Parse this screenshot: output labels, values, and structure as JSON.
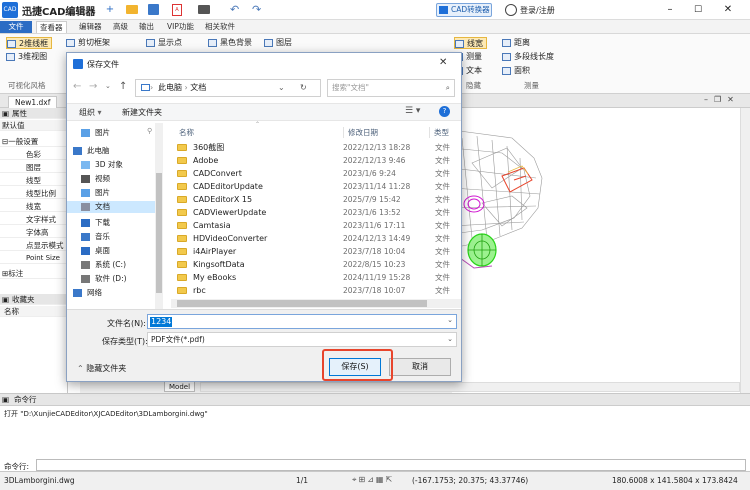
{
  "app": {
    "logo": "CAD",
    "title": "迅捷CAD编辑器",
    "converter": "CAD转换器",
    "login": "登录/注册"
  },
  "menu": [
    "文件",
    "查看器",
    "编辑器",
    "高级",
    "输出",
    "VIP功能",
    "相关软件"
  ],
  "ribbon": {
    "col1": [
      "2维线框",
      "3维视图"
    ],
    "group1_label": "可视化风格",
    "col2": [
      "剪切框架",
      "显示点"
    ],
    "col3": [
      "黑色背景",
      "图层"
    ],
    "col4": [
      "线宽",
      "测量",
      "文本"
    ],
    "col4_label": "隐藏",
    "col5": [
      "距离",
      "多段线长度",
      "面积"
    ],
    "col5_label": "测量"
  },
  "doctab": "New1.dxf",
  "leftpanel": {
    "header": "属性",
    "default": "默认值",
    "general": "一般设置",
    "props": [
      "色彩",
      "图层",
      "线型",
      "线型比例",
      "线宽",
      "文字样式",
      "字体高",
      "点显示模式",
      "Point Size"
    ],
    "annotation": "标注",
    "favorites": "收藏夹",
    "name_col": "名称"
  },
  "model_tab": "Model",
  "command": {
    "title": "命令行",
    "log": "打开 \"D:\\XunjieCADEditor\\XJCADEditor\\3DLamborgini.dwg\"",
    "prompt": "命令行:"
  },
  "status": {
    "file": "3DLamborgini.dwg",
    "page": "1/1",
    "coords": "(-167.1753; 20.375; 43.37746)",
    "size": "180.6008 x 141.5804 x 173.8424"
  },
  "dialog": {
    "title": "保存文件",
    "breadcrumb": [
      "此电脑",
      "文档"
    ],
    "search_placeholder": "搜索\"文档\"",
    "organize": "组织",
    "new_folder": "新建文件夹",
    "nav": [
      {
        "label": "图片",
        "icon": "picture-icon"
      },
      {
        "label": "此电脑",
        "icon": "computer-icon"
      },
      {
        "label": "3D 对象",
        "icon": "cube-icon"
      },
      {
        "label": "视频",
        "icon": "video-icon"
      },
      {
        "label": "图片",
        "icon": "picture-icon"
      },
      {
        "label": "文档",
        "icon": "document-icon"
      },
      {
        "label": "下载",
        "icon": "download-icon"
      },
      {
        "label": "音乐",
        "icon": "music-icon"
      },
      {
        "label": "桌面",
        "icon": "desktop-icon"
      },
      {
        "label": "系统 (C:)",
        "icon": "drive-icon"
      },
      {
        "label": "软件 (D:)",
        "icon": "drive-icon"
      },
      {
        "label": "网络",
        "icon": "network-icon"
      }
    ],
    "columns": [
      "名称",
      "修改日期",
      "类型"
    ],
    "files": [
      {
        "name": "360截图",
        "date": "2022/12/13 18:28",
        "type": "文件"
      },
      {
        "name": "Adobe",
        "date": "2022/12/13 9:46",
        "type": "文件"
      },
      {
        "name": "CADConvert",
        "date": "2023/1/6 9:24",
        "type": "文件"
      },
      {
        "name": "CADEditorUpdate",
        "date": "2023/11/14 11:28",
        "type": "文件"
      },
      {
        "name": "CADEditorX 15",
        "date": "2025/7/9 15:42",
        "type": "文件"
      },
      {
        "name": "CADViewerUpdate",
        "date": "2023/1/6 13:52",
        "type": "文件"
      },
      {
        "name": "Camtasia",
        "date": "2023/11/6 17:11",
        "type": "文件"
      },
      {
        "name": "HDVideoConverter",
        "date": "2024/12/13 14:49",
        "type": "文件"
      },
      {
        "name": "i4AirPlayer",
        "date": "2023/7/18 10:04",
        "type": "文件"
      },
      {
        "name": "KingsoftData",
        "date": "2022/8/15 10:23",
        "type": "文件"
      },
      {
        "name": "My eBooks",
        "date": "2024/11/19 15:28",
        "type": "文件"
      },
      {
        "name": "rbc",
        "date": "2023/7/18 10:07",
        "type": "文件"
      }
    ],
    "filename_label": "文件名(N):",
    "filename_value": "1234",
    "filetype_label": "保存类型(T):",
    "filetype_value": "PDF文件(*.pdf)",
    "hide_folders": "隐藏文件夹",
    "save": "保存(S)",
    "cancel": "取消"
  },
  "colors": {
    "accent": "#2b6cc4",
    "highlight": "#e8452c",
    "selection": "#cce8ff"
  }
}
